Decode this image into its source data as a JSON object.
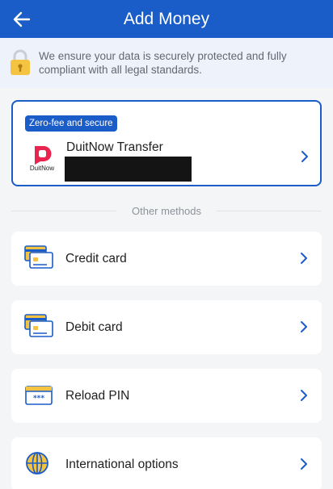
{
  "header": {
    "title": "Add Money"
  },
  "notice": {
    "text": "We ensure your data is securely protected and fully compliant with all legal standards."
  },
  "featured": {
    "badge": "Zero-fee and secure",
    "logo_text": "DuitNow",
    "title": "DuitNow Transfer"
  },
  "divider": {
    "label": "Other methods"
  },
  "methods": [
    {
      "label": "Credit card",
      "icon": "credit-card-icon"
    },
    {
      "label": "Debit card",
      "icon": "debit-card-icon"
    },
    {
      "label": "Reload PIN",
      "icon": "reload-pin-icon"
    },
    {
      "label": "International options",
      "icon": "globe-icon"
    }
  ],
  "colors": {
    "brand": "#1a5cc8",
    "accent_yellow": "#f5c342",
    "duitnow": "#e8244f",
    "background": "#f4f5f7"
  }
}
